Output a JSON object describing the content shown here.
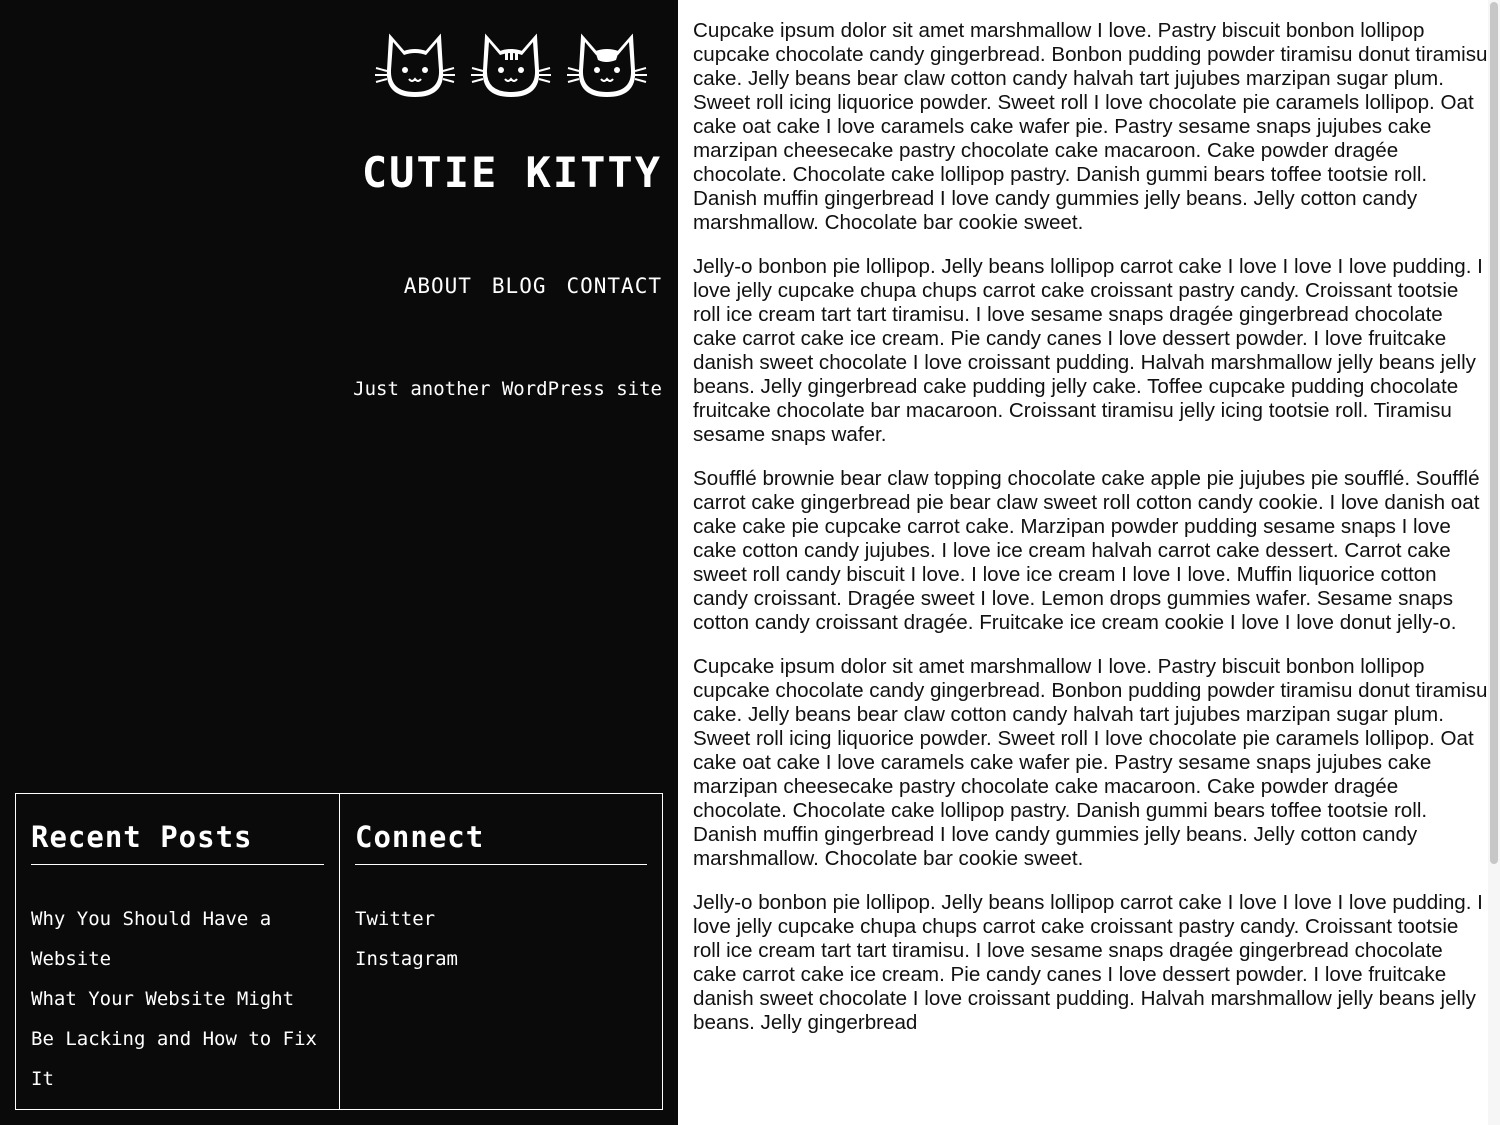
{
  "header": {
    "site_title": "CUTIE KITTY",
    "tagline": "Just another WordPress site",
    "cat_icons": [
      "cat-face-icon",
      "striped-cat-face-icon",
      "spotted-cat-face-icon"
    ]
  },
  "nav": {
    "items": [
      {
        "label": "ABOUT"
      },
      {
        "label": "BLOG"
      },
      {
        "label": "CONTACT"
      }
    ]
  },
  "widgets": {
    "recent_posts": {
      "title": "Recent Posts",
      "items": [
        {
          "label": "Why You Should Have a Website"
        },
        {
          "label": "What Your Website Might Be Lacking and How to Fix It"
        }
      ]
    },
    "connect": {
      "title": "Connect",
      "items": [
        {
          "label": "Twitter"
        },
        {
          "label": "Instagram"
        }
      ]
    }
  },
  "content": {
    "paragraphs": [
      "Cupcake ipsum dolor sit amet marshmallow I love. Pastry biscuit bonbon lollipop cupcake chocolate candy gingerbread. Bonbon pudding powder tiramisu donut tiramisu cake. Jelly beans bear claw cotton candy halvah tart jujubes marzipan sugar plum. Sweet roll icing liquorice powder. Sweet roll I love chocolate pie caramels lollipop. Oat cake oat cake I love caramels cake wafer pie. Pastry sesame snaps jujubes cake marzipan cheesecake pastry chocolate cake macaroon. Cake powder dragée chocolate. Chocolate cake lollipop pastry. Danish gummi bears toffee tootsie roll. Danish muffin gingerbread I love candy gummies jelly beans. Jelly cotton candy marshmallow. Chocolate bar cookie sweet.",
      "Jelly-o bonbon pie lollipop. Jelly beans lollipop carrot cake I love I love I love pudding. I love jelly cupcake chupa chups carrot cake croissant pastry candy. Croissant tootsie roll ice cream tart tart tiramisu. I love sesame snaps dragée gingerbread chocolate cake carrot cake ice cream. Pie candy canes I love dessert powder. I love fruitcake danish sweet chocolate I love croissant pudding. Halvah marshmallow jelly beans jelly beans. Jelly gingerbread cake pudding jelly cake. Toffee cupcake pudding chocolate fruitcake chocolate bar macaroon. Croissant tiramisu jelly icing tootsie roll. Tiramisu sesame snaps wafer.",
      "Soufflé brownie bear claw topping chocolate cake apple pie jujubes pie soufflé. Soufflé carrot cake gingerbread pie bear claw sweet roll cotton candy cookie. I love danish oat cake cake pie cupcake carrot cake. Marzipan powder pudding sesame snaps I love cake cotton candy jujubes. I love ice cream halvah carrot cake dessert. Carrot cake sweet roll candy biscuit I love. I love ice cream I love I love. Muffin liquorice cotton candy croissant. Dragée sweet I love. Lemon drops gummies wafer. Sesame snaps cotton candy croissant dragée. Fruitcake ice cream cookie I love I love donut jelly-o.",
      "Cupcake ipsum dolor sit amet marshmallow I love. Pastry biscuit bonbon lollipop cupcake chocolate candy gingerbread. Bonbon pudding powder tiramisu donut tiramisu cake. Jelly beans bear claw cotton candy halvah tart jujubes marzipan sugar plum. Sweet roll icing liquorice powder. Sweet roll I love chocolate pie caramels lollipop. Oat cake oat cake I love caramels cake wafer pie. Pastry sesame snaps jujubes cake marzipan cheesecake pastry chocolate cake macaroon. Cake powder dragée chocolate. Chocolate cake lollipop pastry. Danish gummi bears toffee tootsie roll. Danish muffin gingerbread I love candy gummies jelly beans. Jelly cotton candy marshmallow. Chocolate bar cookie sweet.",
      "Jelly-o bonbon pie lollipop. Jelly beans lollipop carrot cake I love I love I love pudding. I love jelly cupcake chupa chups carrot cake croissant pastry candy. Croissant tootsie roll ice cream tart tart tiramisu. I love sesame snaps dragée gingerbread chocolate cake carrot cake ice cream. Pie candy canes I love dessert powder. I love fruitcake danish sweet chocolate I love croissant pudding. Halvah marshmallow jelly beans jelly beans. Jelly gingerbread"
    ]
  },
  "colors": {
    "sidebar_background": "#0a0a0b",
    "sidebar_text": "#ffffff",
    "content_background": "#ffffff",
    "content_text": "#111111"
  }
}
